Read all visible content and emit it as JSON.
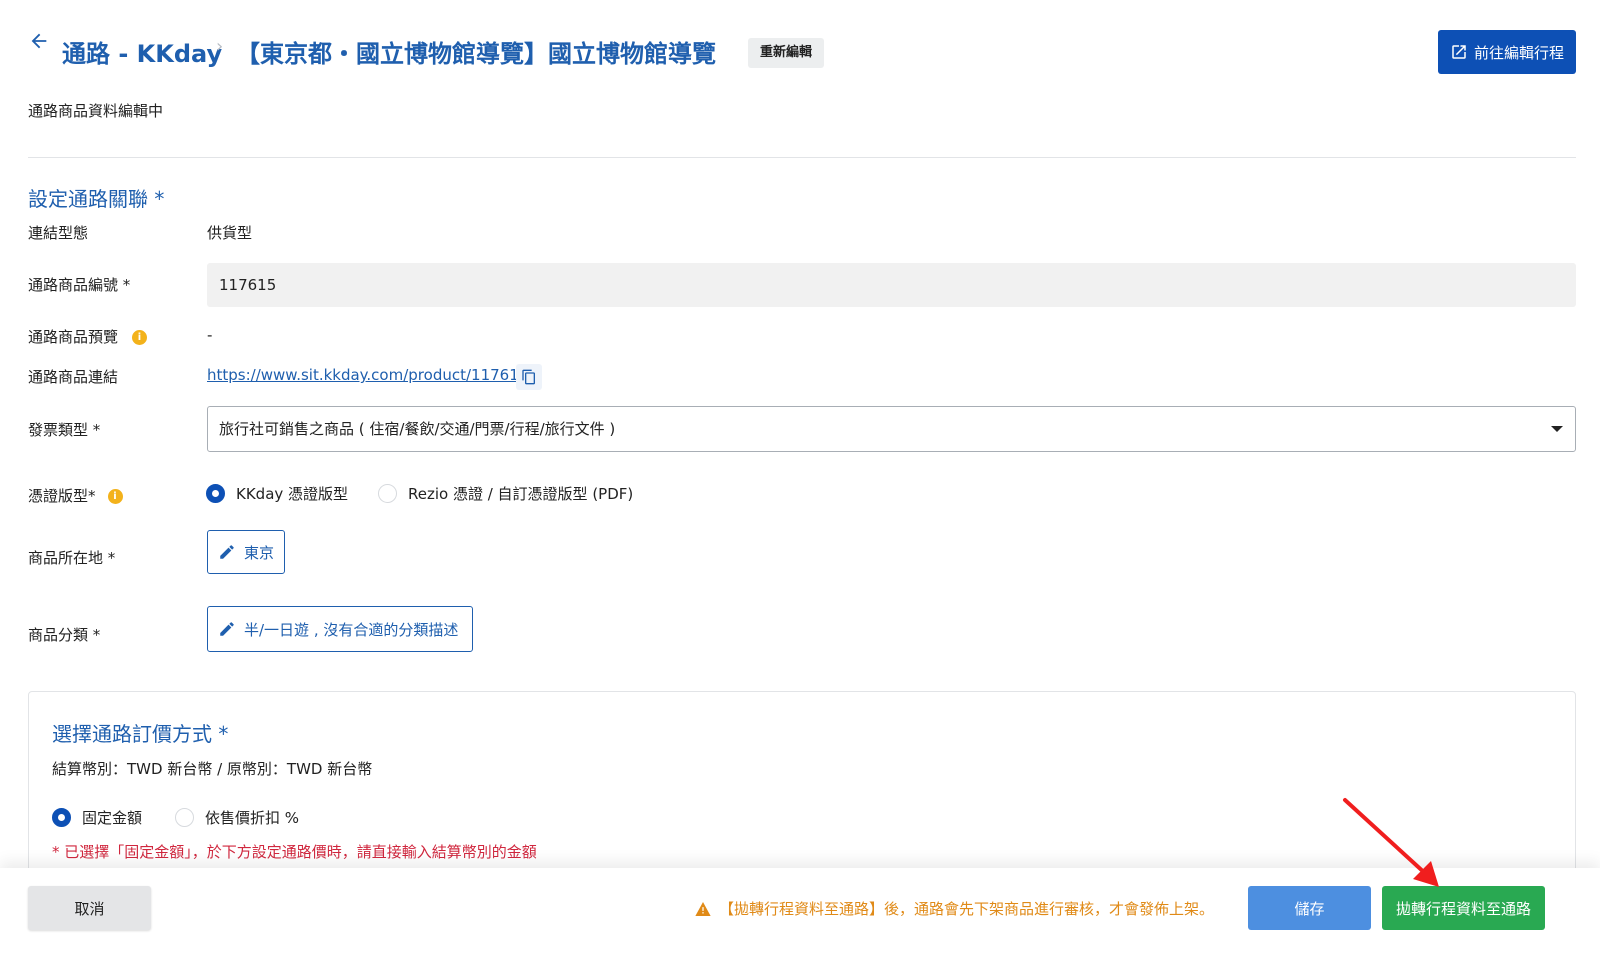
{
  "header": {
    "back_icon": "arrow-left-icon",
    "channel_crumb": "通路 - KKday",
    "separator": "›",
    "title": "【東京都・國立博物館導覽】國立博物館導覽",
    "badge": "重新編輯",
    "edit_itinerary_button": "前往編輯行程",
    "edit_itinerary_icon": "open-external-icon"
  },
  "status_text": "通路商品資料編輯中",
  "section": {
    "title": "設定通路關聯 *",
    "fields": {
      "link_type_label": "連結型態",
      "link_type_value": "供貨型",
      "product_id_label": "通路商品編號 *",
      "product_id_value": "117615",
      "preview_label": "通路商品預覽",
      "preview_value": "-",
      "product_link_label": "通路商品連結",
      "product_link_value": "https://www.sit.kkday.com/product/117615",
      "invoice_type_label": "發票類型 *",
      "invoice_type_value": "旅行社可銷售之商品 ( 住宿/餐飲/交通/門票/行程/旅行文件 )",
      "voucher_label": "憑證版型*",
      "voucher_options": [
        "KKday 憑證版型",
        "Rezio 憑證 / 自訂憑證版型 (PDF)"
      ],
      "voucher_selected": "KKday 憑證版型",
      "location_label": "商品所在地 *",
      "location_value": "東京",
      "category_label": "商品分類 *",
      "category_value": "半/一日遊 , 沒有合適的分類描述"
    }
  },
  "pricing": {
    "title": "選擇通路訂價方式 *",
    "currency_text": "結算幣別：TWD 新台幣 / 原幣別：TWD 新台幣",
    "options": [
      "固定金額",
      "依售價折扣 %"
    ],
    "selected": "固定金額",
    "note": "* 已選擇「固定金額」，於下方設定通路價時，請直接輸入結算幣別的金額"
  },
  "footer": {
    "cancel": "取消",
    "warning": "【拋轉行程資料至通路】後，通路會先下架商品進行審核，才會發佈上架。",
    "save": "儲存",
    "transfer": "拋轉行程資料至通路"
  },
  "colors": {
    "primary": "#0d50b5",
    "title_blue": "#1f5fae",
    "save_blue": "#4d8fe0",
    "transfer_green": "#29a952",
    "warning_orange": "#e08a17",
    "error_red": "#d0273e",
    "annotation_red": "#f01e1e"
  }
}
